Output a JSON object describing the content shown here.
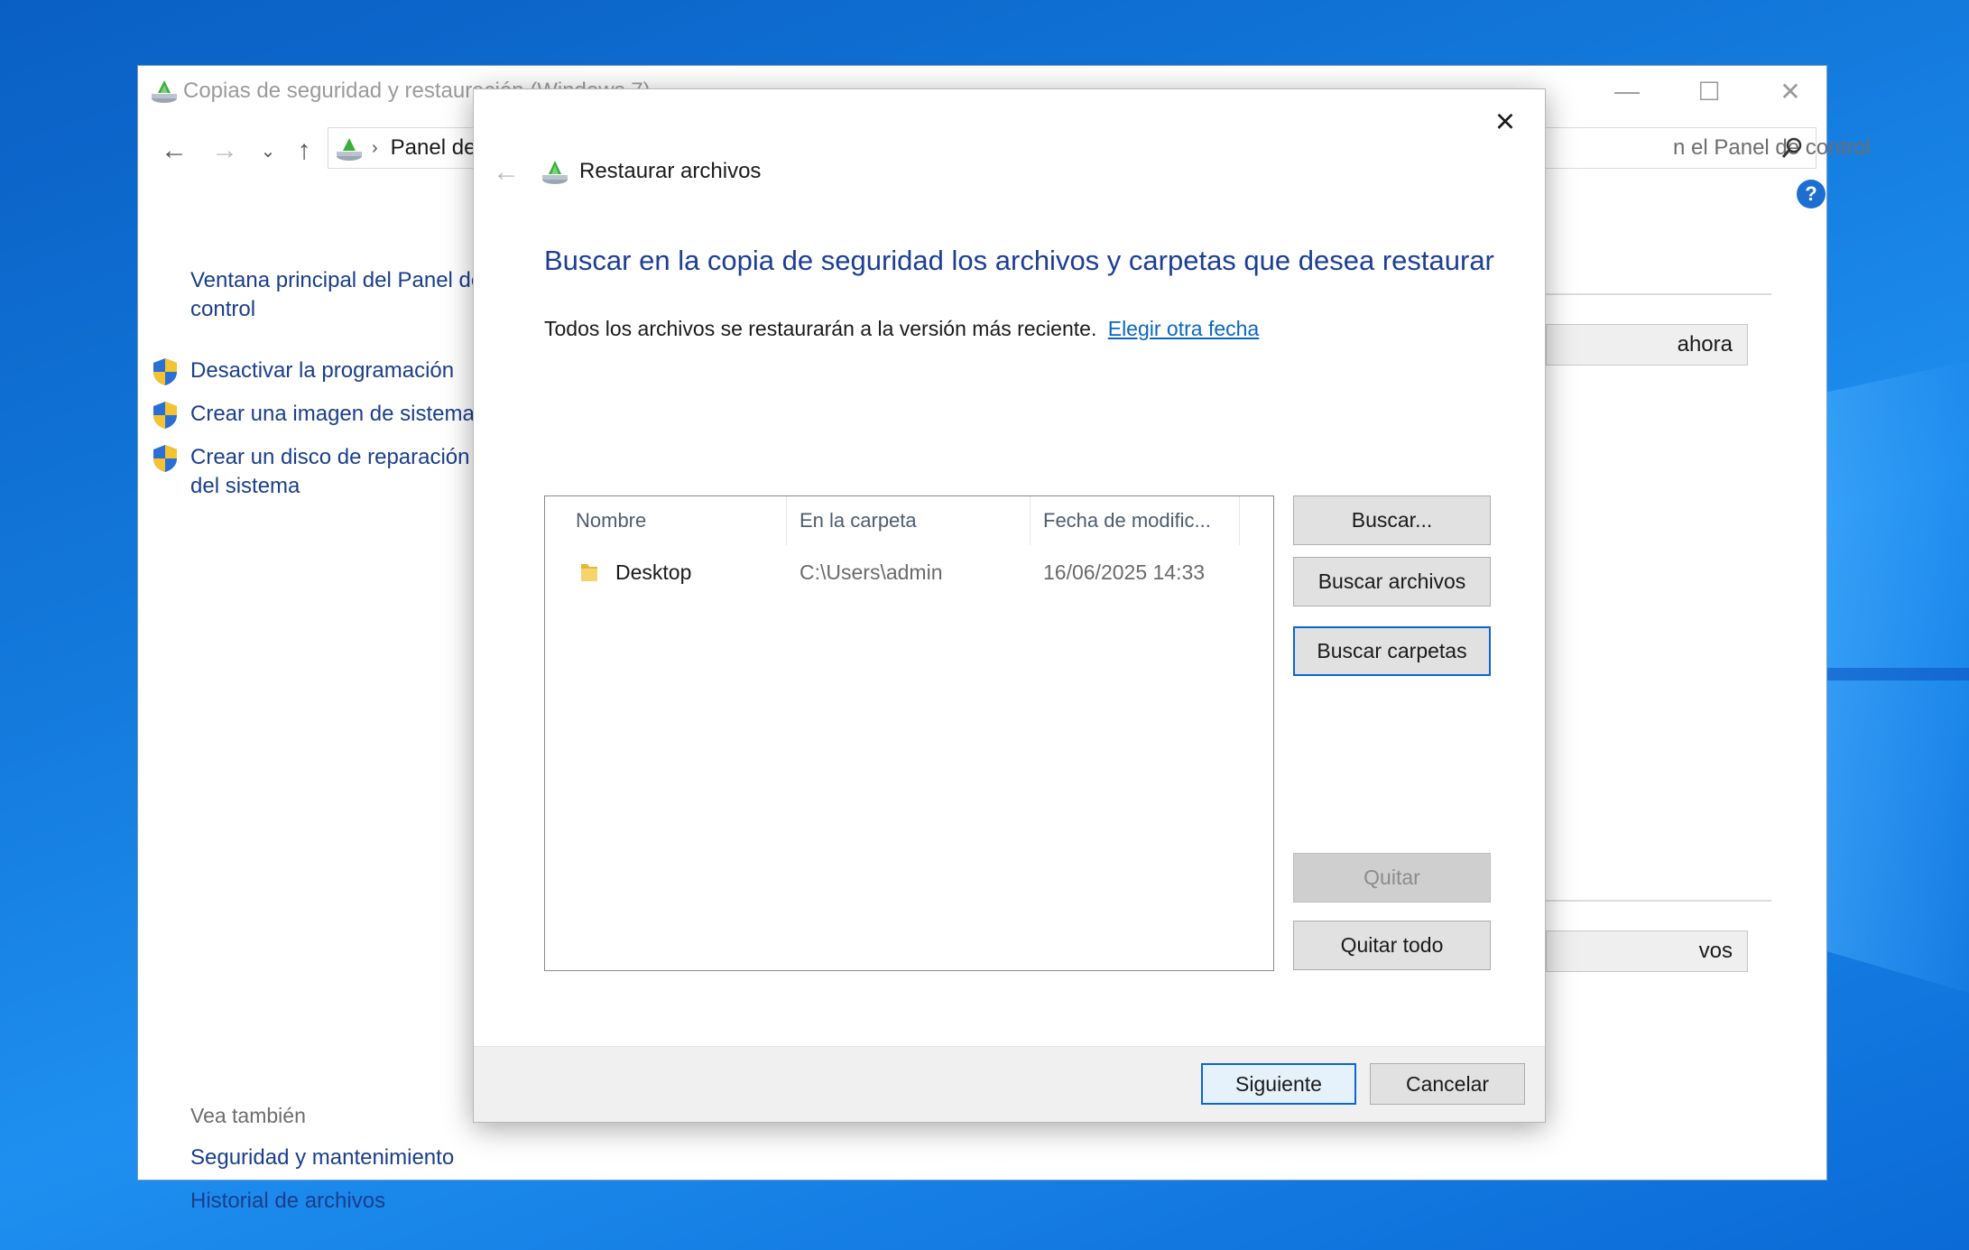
{
  "background_window": {
    "title": "Copias de seguridad y restauración (Windows 7)",
    "window_controls": {
      "minimize": "—",
      "maximize": "☐",
      "close": "✕"
    },
    "address_text": "Panel de",
    "search_text": "n el Panel de control",
    "left_links": [
      "Ventana principal del Panel de control",
      "Desactivar la programación",
      "Crear una imagen de sistema",
      "Crear un disco de reparación del sistema"
    ],
    "see_also_label": "Vea también",
    "see_also_links": [
      "Seguridad y mantenimiento",
      "Historial de archivos"
    ],
    "bg_button_1": "ahora",
    "bg_button_2": "vos"
  },
  "dialog": {
    "title": "Restaurar archivos",
    "heading": "Buscar en la copia de seguridad los archivos y carpetas que desea restaurar",
    "description": "Todos los archivos se restaurarán a la versión más reciente.",
    "link": "Elegir otra fecha",
    "columns": [
      "Nombre",
      "En la carpeta",
      "Fecha de modific..."
    ],
    "rows": [
      {
        "name": "Desktop",
        "folder": "C:\\Users\\admin",
        "date": "16/06/2025 14:33"
      }
    ],
    "buttons": {
      "search": "Buscar...",
      "search_files": "Buscar archivos",
      "search_folders": "Buscar carpetas",
      "remove": "Quitar",
      "remove_all": "Quitar todo"
    },
    "footer": {
      "next": "Siguiente",
      "cancel": "Cancelar"
    }
  }
}
